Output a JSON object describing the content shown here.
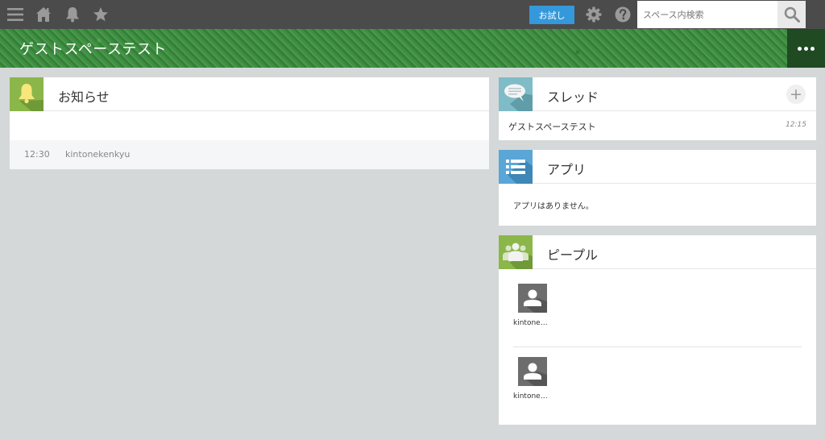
{
  "topbar": {
    "icons": [
      "menu-icon",
      "home-icon",
      "bell-icon",
      "star-icon",
      "gear-icon",
      "help-icon",
      "search-icon"
    ],
    "trial_label": "お試し",
    "search_placeholder": "スペース内検索"
  },
  "space": {
    "title": "ゲストスペーステスト"
  },
  "notices": {
    "title": "お知らせ",
    "icon_color": "#8bb64a",
    "items": [
      {
        "time": "12:30",
        "user": "kintonekenkyu"
      }
    ]
  },
  "threads": {
    "title": "スレッド",
    "icon_color": "#7fbcc7",
    "items": [
      {
        "name": "ゲストスペーステスト",
        "time": "12:15"
      }
    ]
  },
  "apps": {
    "title": "アプリ",
    "icon_color": "#5aa6d6",
    "empty_message": "アプリはありません。"
  },
  "people": {
    "title": "ピープル",
    "icon_color": "#8bb64a",
    "members": [
      {
        "name": "kintone…"
      },
      {
        "name": "kintone…"
      }
    ]
  }
}
